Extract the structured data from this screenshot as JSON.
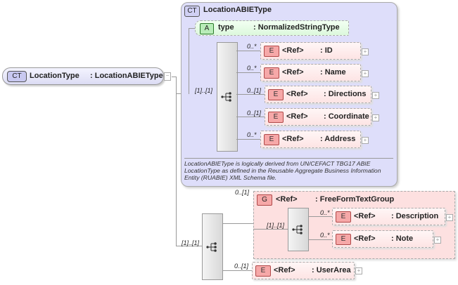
{
  "root": {
    "badge": "CT",
    "name": "LocationType",
    "type": ": LocationABIEType"
  },
  "complex_type": {
    "badge": "CT",
    "title": "LocationABIEType",
    "attribute": {
      "badge": "A",
      "name": "type",
      "type": ": NormalizedStringType"
    },
    "sequence_multiplicity": "[1]..[1]",
    "elements": [
      {
        "mult": "0..*",
        "badge": "E",
        "ref": "<Ref>",
        "name": ": ID"
      },
      {
        "mult": "0..*",
        "badge": "E",
        "ref": "<Ref>",
        "name": ": Name"
      },
      {
        "mult": "0..[1]",
        "badge": "E",
        "ref": "<Ref>",
        "name": ": Directions"
      },
      {
        "mult": "0..[1]",
        "badge": "E",
        "ref": "<Ref>",
        "name": ": Coordinate"
      },
      {
        "mult": "0..*",
        "badge": "E",
        "ref": "<Ref>",
        "name": ": Address"
      }
    ],
    "documentation": "LocationABIEType is logically derived from UN/CEFACT TBG17 ABIE LocationType as defined in the Reusable Aggregate Business Information Entity (RUABIE) XML Schema file."
  },
  "sequence2": {
    "mult": "[1]..[1]"
  },
  "group": {
    "mult": "0..[1]",
    "badge": "G",
    "ref": "<Ref>",
    "name": ": FreeFormTextGroup",
    "seq_mult": "[1]..[1]",
    "elements": [
      {
        "mult": "0..*",
        "badge": "E",
        "ref": "<Ref>",
        "name": ": Description"
      },
      {
        "mult": "0..*",
        "badge": "E",
        "ref": "<Ref>",
        "name": ": Note"
      }
    ]
  },
  "user_area": {
    "mult": "0..[1]",
    "badge": "E",
    "ref": "<Ref>",
    "name": ": UserArea"
  },
  "plus": "+",
  "minus": "−"
}
